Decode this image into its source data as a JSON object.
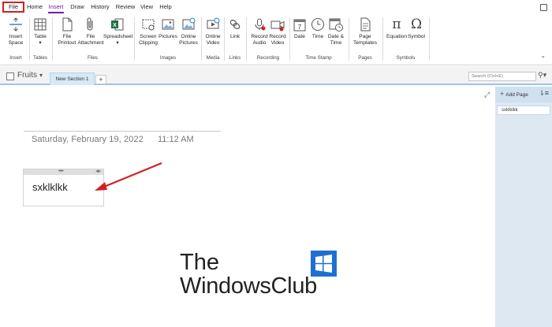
{
  "tabs": [
    "File",
    "Home",
    "Insert",
    "Draw",
    "History",
    "Review",
    "View",
    "Help"
  ],
  "ribbon": {
    "insert_space": "Insert\nSpace",
    "table": "Table",
    "file_printout": "File\nPrintout",
    "file_attachment": "File\nAttachment",
    "spreadsheet": "Spreadsheet",
    "screen_clipping": "Screen\nClipping",
    "pictures": "Pictures",
    "online_pictures": "Online\nPictures",
    "online_video": "Online\nVideo",
    "link": "Link",
    "record_audio": "Record\nAudio",
    "record_video": "Record\nVideo",
    "date": "Date",
    "time": "Time",
    "date_time": "Date &\nTime",
    "page_templates": "Page\nTemplates",
    "equation": "Equation",
    "symbol": "Symbol",
    "groups": {
      "insert": "Insert",
      "tables": "Tables",
      "files": "Files",
      "images": "Images",
      "media": "Media",
      "links": "Links",
      "recording": "Recording",
      "time_stamp": "Time Stamp",
      "pages": "Pages",
      "symbols": "Symbols"
    }
  },
  "notebook": {
    "name": "Fruits",
    "section": "New Section 1",
    "add_section": "+",
    "search_placeholder": "Search (Ctrl+E)"
  },
  "page": {
    "date": "Saturday, February 19, 2022",
    "time": "11:12 AM",
    "note_text": "sxklklkk"
  },
  "pane": {
    "add_page": "Add Page",
    "pages": [
      "sxklklkk"
    ]
  },
  "watermark": {
    "line1": "The",
    "line2": "WindowsClub"
  },
  "colors": {
    "accent": "#7719aa",
    "highlight_box": "#d32020",
    "arrow": "#d32020",
    "section_tab": "#d7e8f7",
    "pane_bg": "#dde8f3"
  }
}
